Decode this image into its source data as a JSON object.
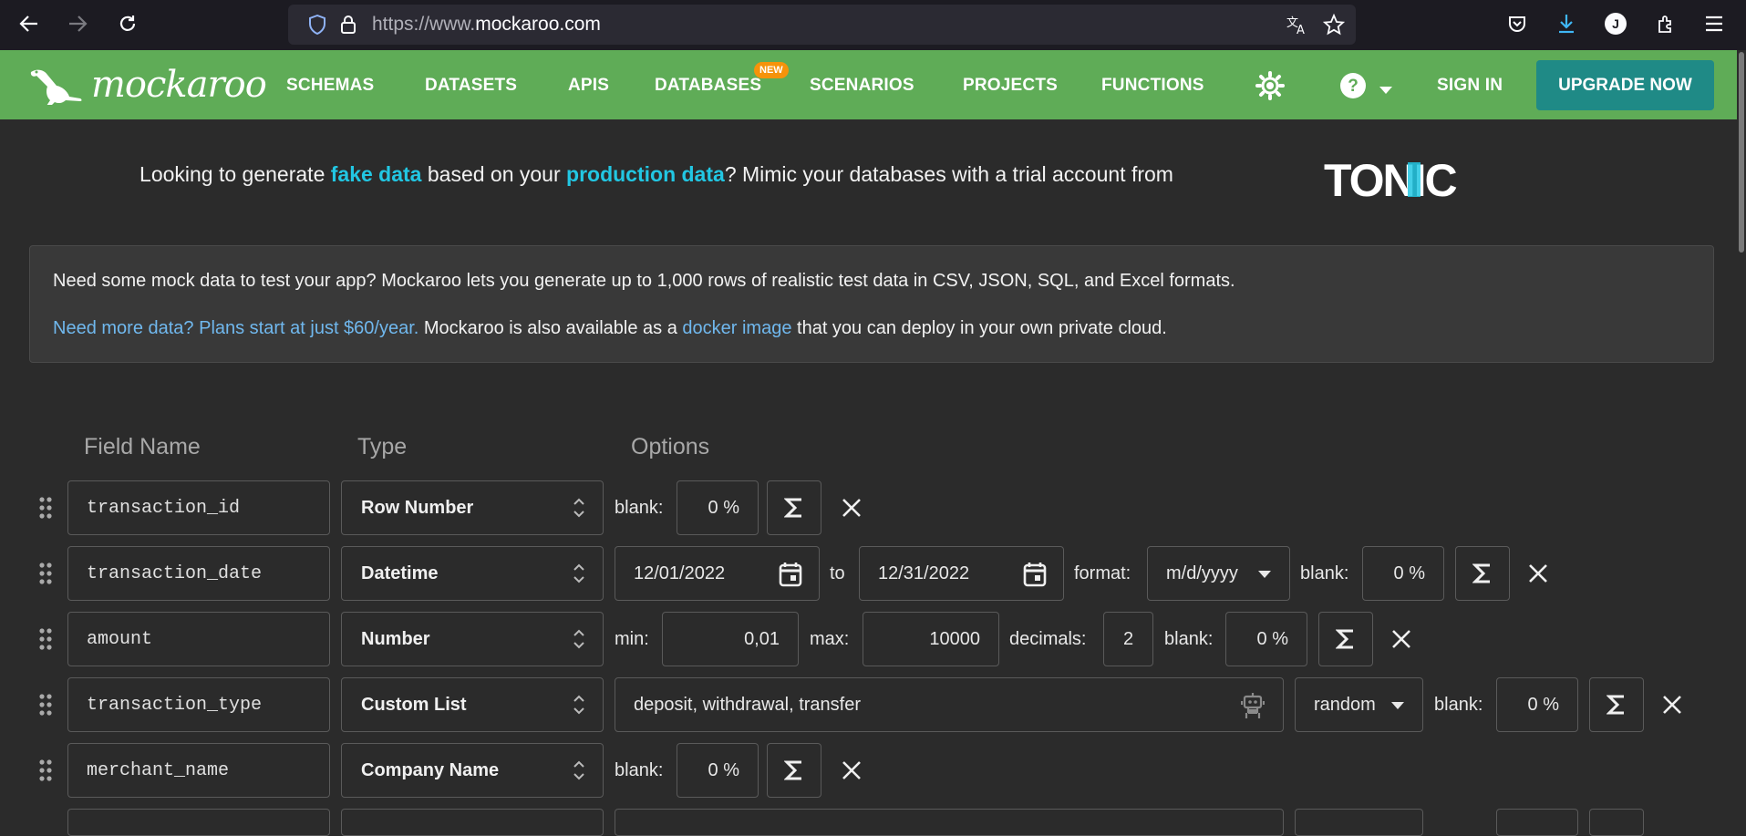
{
  "browser": {
    "url_prefix": "https://www.",
    "url_domain": "mockaroo.com",
    "profile_initial": "J"
  },
  "nav": {
    "logo": "mockaroo",
    "items": [
      "SCHEMAS",
      "DATASETS",
      "APIS",
      "DATABASES",
      "SCENARIOS",
      "PROJECTS",
      "FUNCTIONS"
    ],
    "new_badge": "NEW",
    "sign_in": "SIGN IN",
    "upgrade": "UPGRADE NOW"
  },
  "promo": {
    "part1": "Looking to generate ",
    "fake_data": "fake data",
    "part2": " based on your ",
    "production_data": "production data",
    "part3": "? Mimic your databases with a trial account from",
    "tonic": "TONIC"
  },
  "info": {
    "line1": "Need some mock data to test your app? Mockaroo lets you generate up to 1,000 rows of realistic test data in CSV, JSON, SQL, and Excel formats.",
    "plans_link": "Need more data? Plans start at just $60/year.",
    "line2_mid": " Mockaroo is also available as a ",
    "docker_link": "docker image",
    "line2_end": " that you can deploy in your own private cloud."
  },
  "headers": {
    "field_name": "Field Name",
    "type": "Type",
    "options": "Options"
  },
  "labels": {
    "blank": "blank:",
    "to": "to",
    "format": "format:",
    "min": "min:",
    "max": "max:",
    "decimals": "decimals:"
  },
  "rows": [
    {
      "field": "transaction_id",
      "type": "Row Number",
      "blank": "0 %"
    },
    {
      "field": "transaction_date",
      "type": "Datetime",
      "from": "12/01/2022",
      "to": "12/31/2022",
      "format": "m/d/yyyy",
      "blank": "0 %"
    },
    {
      "field": "amount",
      "type": "Number",
      "min": "0,01",
      "max": "10000",
      "decimals": "2",
      "blank": "0 %"
    },
    {
      "field": "transaction_type",
      "type": "Custom List",
      "values": "deposit, withdrawal, transfer",
      "order": "random",
      "blank": "0 %"
    },
    {
      "field": "merchant_name",
      "type": "Company Name",
      "blank": "0 %"
    }
  ],
  "colors": {
    "nav_green": "#5fac57",
    "upgrade_teal": "#1f8a86",
    "highlight_cyan": "#22c7e3",
    "link_blue": "#70b8ee",
    "badge_orange": "#f5930a"
  }
}
